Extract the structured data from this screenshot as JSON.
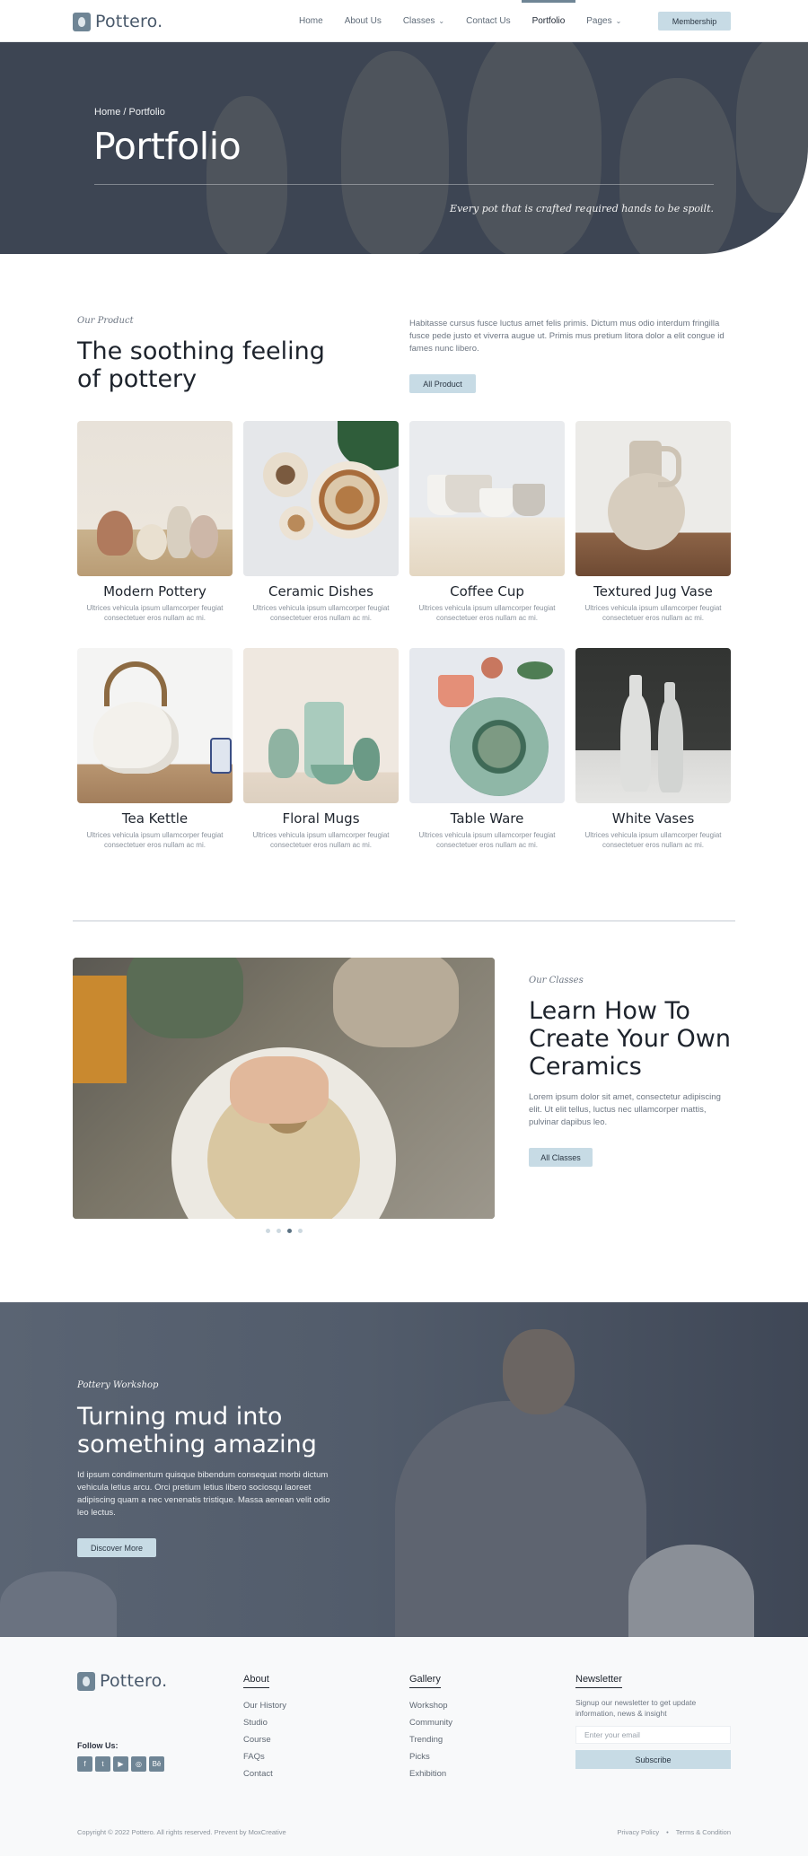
{
  "brand": {
    "name": "Pottero."
  },
  "nav": {
    "items": [
      {
        "label": "Home",
        "dropdown": false,
        "active": false
      },
      {
        "label": "About Us",
        "dropdown": false,
        "active": false
      },
      {
        "label": "Classes",
        "dropdown": true,
        "active": false
      },
      {
        "label": "Contact Us",
        "dropdown": false,
        "active": false
      },
      {
        "label": "Portfolio",
        "dropdown": false,
        "active": true
      },
      {
        "label": "Pages",
        "dropdown": true,
        "active": false
      }
    ],
    "cta": "Membership"
  },
  "hero": {
    "breadcrumb": "Home / Portfolio",
    "title": "Portfolio",
    "quote": "Every pot that is crafted required hands to be spoilt."
  },
  "products": {
    "eyebrow": "Our Product",
    "title": "The soothing feeling of pottery",
    "description": "Habitasse cursus fusce luctus amet felis primis. Dictum mus odio interdum fringilla fusce pede justo et viverra augue ut. Primis mus pretium litora dolor a elit congue id fames nunc libero.",
    "button": "All Product",
    "items": [
      {
        "name": "Modern Pottery",
        "desc": "Ultrices vehicula ipsum ullamcorper feugiat consectetuer eros nullam ac mi."
      },
      {
        "name": "Ceramic Dishes",
        "desc": "Ultrices vehicula ipsum ullamcorper feugiat consectetuer eros nullam ac mi."
      },
      {
        "name": "Coffee Cup",
        "desc": "Ultrices vehicula ipsum ullamcorper feugiat consectetuer eros nullam ac mi."
      },
      {
        "name": "Textured Jug Vase",
        "desc": "Ultrices vehicula ipsum ullamcorper feugiat consectetuer eros nullam ac mi."
      },
      {
        "name": "Tea Kettle",
        "desc": "Ultrices vehicula ipsum ullamcorper feugiat consectetuer eros nullam ac mi."
      },
      {
        "name": "Floral Mugs",
        "desc": "Ultrices vehicula ipsum ullamcorper feugiat consectetuer eros nullam ac mi."
      },
      {
        "name": "Table Ware",
        "desc": "Ultrices vehicula ipsum ullamcorper feugiat consectetuer eros nullam ac mi."
      },
      {
        "name": "White Vases",
        "desc": "Ultrices vehicula ipsum ullamcorper feugiat consectetuer eros nullam ac mi."
      }
    ]
  },
  "classes": {
    "eyebrow": "Our Classes",
    "title": "Learn How To Create Your Own Ceramics",
    "description": "Lorem ipsum dolor sit amet, consectetur adipiscing elit. Ut elit tellus, luctus nec ullamcorper mattis, pulvinar dapibus leo.",
    "button": "All Classes",
    "slides": 4,
    "active_slide": 3
  },
  "workshop": {
    "eyebrow": "Pottery Workshop",
    "title": "Turning mud into something amazing",
    "description": "Id ipsum condimentum quisque bibendum consequat morbi dictum vehicula letius arcu. Orci pretium letius libero sociosqu laoreet adipiscing quam a nec venenatis tristique. Massa aenean velit odio leo lectus.",
    "button": "Discover More"
  },
  "footer": {
    "follow_label": "Follow Us:",
    "socials": [
      "f",
      "t",
      "▶",
      "◎",
      "Bē"
    ],
    "columns": [
      {
        "title": "About",
        "links": [
          "Our History",
          "Studio",
          "Course",
          "FAQs",
          "Contact"
        ]
      },
      {
        "title": "Gallery",
        "links": [
          "Workshop",
          "Community",
          "Trending",
          "Picks",
          "Exhibition"
        ]
      }
    ],
    "newsletter": {
      "title": "Newsletter",
      "text": "Signup our newsletter to get update information, news & insight",
      "placeholder": "Enter your email",
      "button": "Subscribe"
    },
    "copyright": "Copyright © 2022 Pottero. All rights reserved. Prevent by MoxCreative",
    "legal": [
      "Privacy Policy",
      "Terms & Condition"
    ]
  },
  "colors": {
    "accent": "#6f8595",
    "button": "#c7dbe5",
    "hero": "#3d4553",
    "workshop": "#4d5767"
  }
}
